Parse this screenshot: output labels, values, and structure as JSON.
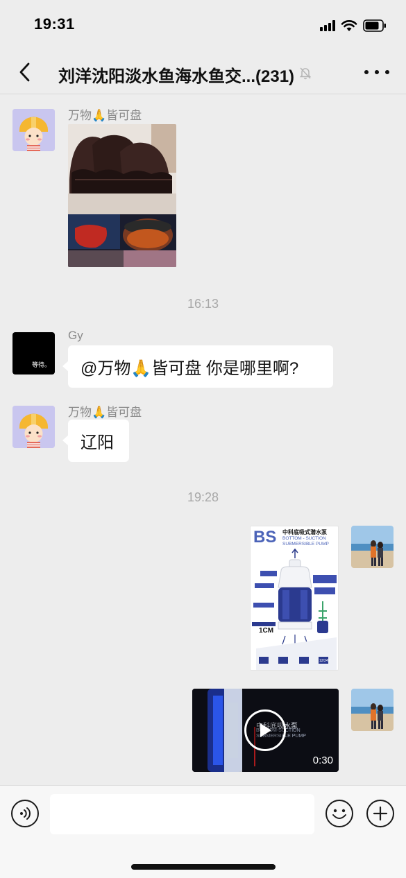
{
  "status_bar": {
    "time": "19:31"
  },
  "header": {
    "title": "刘洋沈阳淡水鱼海水鱼交...(231)"
  },
  "messages": [
    {
      "sender": "万物🙏皆可盘",
      "type": "image"
    },
    {
      "timestamp": "16:13"
    },
    {
      "sender": "Gy",
      "avatar_text": "等待。",
      "text": "@万物🙏皆可盘 你是哪里啊?"
    },
    {
      "sender": "万物🙏皆可盘",
      "text": "辽阳"
    },
    {
      "timestamp": "19:28"
    },
    {
      "type": "image",
      "from_self": true,
      "image_text": {
        "brand": "BS",
        "title_cn": "中科底吸式潜水泵",
        "title_en_1": "BOTTOM - SUCTION",
        "title_en_2": "SUBMERSIBLE PUMP",
        "size_label": "1CM",
        "voltage": "12/24V"
      }
    },
    {
      "type": "video",
      "from_self": true,
      "duration": "0:30",
      "overlay_cn": "中科底吸水泵",
      "overlay_en_1": "BOTTOM-SUCTION",
      "overlay_en_2": "SUBMERSIBLE PUMP"
    }
  ],
  "input": {
    "placeholder": ""
  },
  "icons": {
    "back": "chevron-left-icon",
    "mute": "bell-off-icon",
    "more": "more-dots-icon",
    "voice": "voice-icon",
    "emoji": "emoji-icon",
    "plus": "plus-icon"
  },
  "colors": {
    "background": "#ededed",
    "bubble": "#ffffff",
    "timestamp": "#a8a8a8",
    "sender": "#8a8a8a"
  }
}
